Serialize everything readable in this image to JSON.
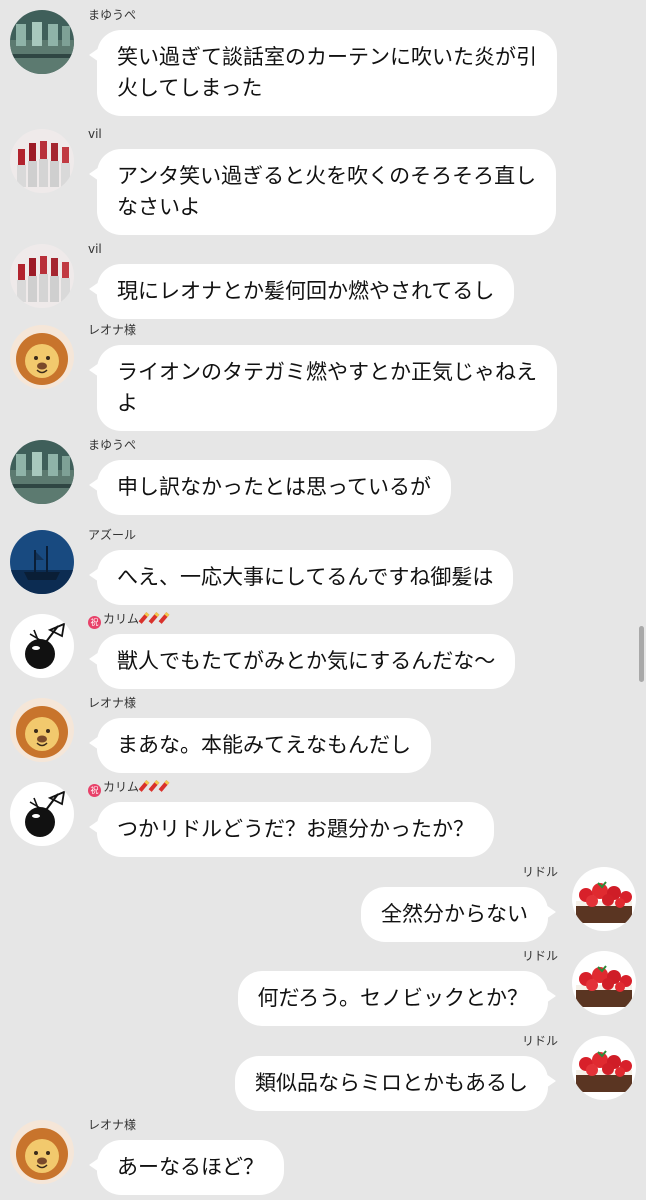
{
  "messages": [
    {
      "side": "left",
      "avatar": "abandoned-building-icon",
      "sender": "まゆうぺ",
      "lines": [
        "笑い過ぎて談話室のカーテンに吹いた炎が引",
        "火してしまった"
      ]
    },
    {
      "side": "left",
      "avatar": "lipsticks-icon",
      "sender": "vil",
      "lines": [
        "アンタ笑い過ぎると火を吹くのそろそろ直し",
        "なさいよ"
      ]
    },
    {
      "side": "left",
      "avatar": "lipsticks-icon",
      "sender": "vil",
      "lines": [
        "現にレオナとか髪何回か燃やされてるし"
      ]
    },
    {
      "side": "left",
      "avatar": "lion-icon",
      "sender": "レオナ様",
      "lines": [
        "ライオンのタテガミ燃やすとか正気じゃねえ",
        "よ"
      ]
    },
    {
      "side": "left",
      "avatar": "abandoned-building-icon",
      "sender": "まゆうぺ",
      "lines": [
        "申し訳なかったとは思っているが"
      ]
    },
    {
      "side": "left",
      "avatar": "underwater-ship-icon",
      "sender": "アズール",
      "lines": [
        "へえ、一応大事にしてるんですね御髪は"
      ]
    },
    {
      "side": "left",
      "avatar": "coconut-drink-icon",
      "sender": "カリム",
      "sender_badge": "祝",
      "sender_firecrackers": 3,
      "lines": [
        "獣人でもたてがみとか気にするんだな～"
      ]
    },
    {
      "side": "left",
      "avatar": "lion-icon",
      "sender": "レオナ様",
      "lines": [
        "まあな。本能みてえなもんだし"
      ]
    },
    {
      "side": "left",
      "avatar": "coconut-drink-icon",
      "sender": "カリム",
      "sender_badge": "祝",
      "sender_firecrackers": 3,
      "lines": [
        "つかリドルどうだ？お題分かったか？"
      ]
    },
    {
      "side": "right",
      "avatar": "strawberry-tart-icon",
      "sender": "リドル",
      "lines": [
        "全然分からない"
      ]
    },
    {
      "side": "right",
      "avatar": "strawberry-tart-icon",
      "sender": "リドル",
      "lines": [
        "何だろう。セノビックとか？"
      ]
    },
    {
      "side": "right",
      "avatar": "strawberry-tart-icon",
      "sender": "リドル",
      "lines": [
        "類似品ならミロとかもあるし"
      ]
    },
    {
      "side": "left",
      "avatar": "lion-icon",
      "sender": "レオナ様",
      "lines": [
        "あーなるほど？"
      ]
    }
  ]
}
